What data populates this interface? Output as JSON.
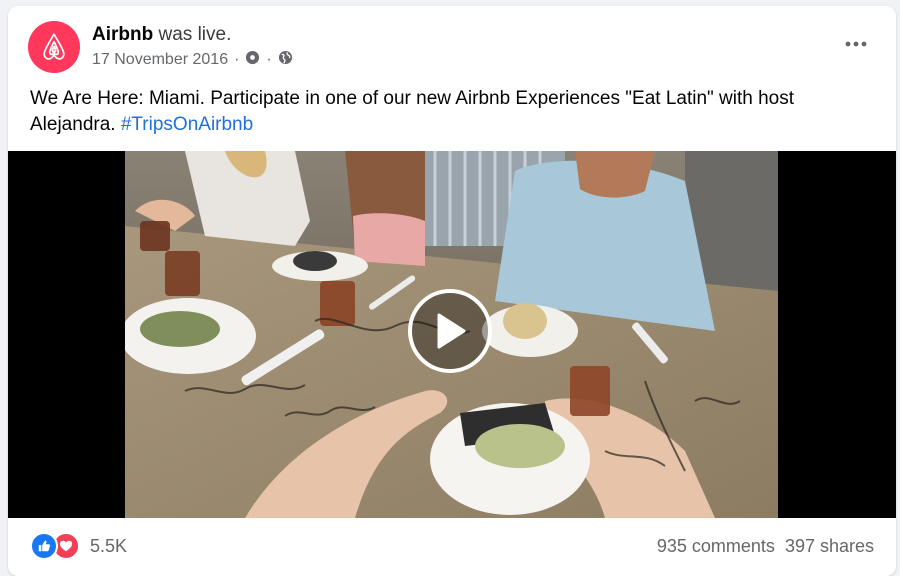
{
  "post": {
    "page_name": "Airbnb",
    "status": "was live.",
    "date": "17 November 2016",
    "separator": "·",
    "caption": "We Are Here: Miami. Participate in one of our new Airbnb Experiences \"Eat Latin\" with host Alejandra.",
    "hashtag": "#TripsOnAirbnb"
  },
  "video": {
    "scene": "Diners at a table with plates of arepas"
  },
  "footer": {
    "reaction_count": "5.5K",
    "comments": "935 comments",
    "shares": "397 shares"
  },
  "colors": {
    "brand": "#ff385c",
    "link": "#216fdb",
    "like": "#1877f2",
    "love": "#f33e58"
  }
}
